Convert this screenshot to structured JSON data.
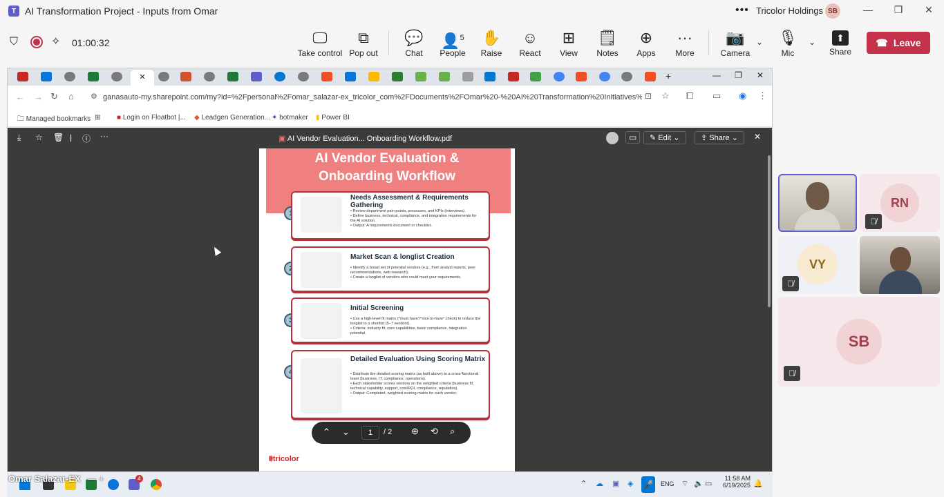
{
  "window": {
    "title": "AI Transformation Project - Inputs from Omar",
    "org": "Tricolor Holdings",
    "org_avatar": "SB"
  },
  "meeting": {
    "timer": "01:00:32",
    "buttons": {
      "take_control": "Take control",
      "pop_out": "Pop out",
      "chat": "Chat",
      "people": "People",
      "people_count": "5",
      "raise": "Raise",
      "react": "React",
      "view": "View",
      "notes": "Notes",
      "apps": "Apps",
      "more": "More",
      "camera": "Camera",
      "mic": "Mic",
      "share": "Share",
      "leave": "Leave"
    }
  },
  "browser": {
    "url": "ganasauto-my.sharepoint.com/my?id=%2Fpersonal%2Fomar_salazar-ex_tricolor_com%2FDocuments%2FOmar%20-%20AI%20Transformation%20Initiatives%2FAI%20Vendo...",
    "bookmarks": [
      "Managed bookmarks",
      "Login on Floatbot |...",
      "Leadgen Generation...",
      "botmaker",
      "Power BI"
    ],
    "colors": {
      "pdf_bg": "#3b3b3b",
      "accent_red": "#b6303c"
    }
  },
  "pdf": {
    "filename": "AI Vendor Evaluation... Onboarding Workflow.pdf",
    "toolbar": {
      "edit": "Edit",
      "share": "Share"
    },
    "page_current": "1",
    "page_total": "/ 2",
    "title_line1": "AI Vendor Evaluation &",
    "title_line2": "Onboarding Workflow",
    "steps": [
      {
        "num": "1",
        "title": "Needs Assessment & Requirements Gathering",
        "bullets": [
          "Review department pain points, processes, and KPIs (interviews).",
          "Define business, technical, compliance, and integration requirements for the AI solution.",
          "Output: A requirements document or checklist."
        ]
      },
      {
        "num": "2",
        "title": "Market Scan & longlist Creation",
        "bullets": [
          "Identify a broad set of potential vendors (e.g., from analyst reports, peer recommendations, web research).",
          "Create a longlist of vendors who could meet your requirements."
        ]
      },
      {
        "num": "3",
        "title": "Initial Screening",
        "bullets": [
          "Use a high-level fit matrix (\"must-have\"/\"nice-to-have\" check) to reduce the longlist to a shortlist (5–7 vendors).",
          "Criteria: industry fit, core capabilities, basic compliance, integration potential."
        ]
      },
      {
        "num": "4",
        "title": "Detailed Evaluation Using Scoring Matrix",
        "bullets": [
          "Distribute the detailed scoring matrix (as built above) to a cross-functional team (business, IT, compliance, operations).",
          "Each stakeholder scores vendors on the weighted criteria (business fit, technical capability, support, cost/ROI, compliance, reputation).",
          "Output: Completed, weighted scoring matrix for each vendor."
        ]
      }
    ],
    "logo": "tricolor"
  },
  "participants": {
    "tiles": [
      {
        "initials": "",
        "type": "video"
      },
      {
        "initials": "RN",
        "type": "avatar"
      },
      {
        "initials": "VY",
        "type": "avatar"
      },
      {
        "initials": "",
        "type": "video"
      },
      {
        "initials": "SB",
        "type": "avatar"
      }
    ]
  },
  "taskbar": {
    "presenter": "Omar Salazar-EX",
    "teams_badge": "4",
    "lang": "ENG",
    "time": "11:58 AM",
    "date": "6/19/2025"
  }
}
